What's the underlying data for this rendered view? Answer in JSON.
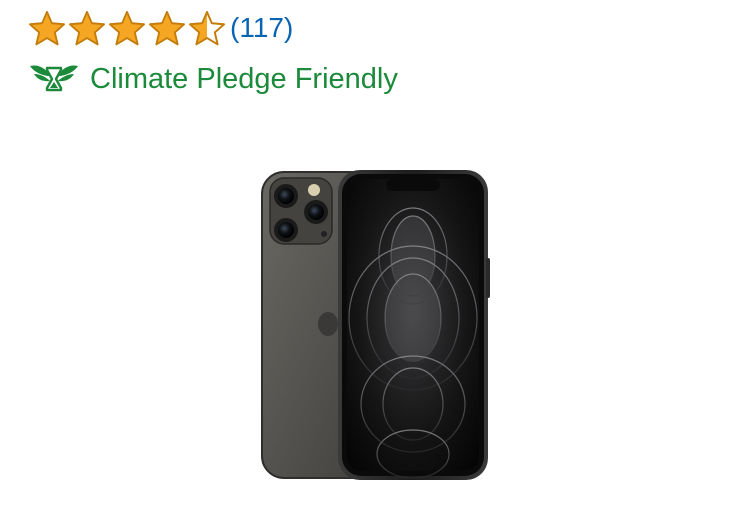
{
  "rating": {
    "value": 4.5,
    "max": 5,
    "review_count": "(117)",
    "star_color": "#f5a623",
    "star_outline": "#c47d0b",
    "link_color": "#0a64b4"
  },
  "badge": {
    "label": "Climate Pledge Friendly",
    "icon": "climate-pledge-leaf-icon",
    "color": "#1b8a3a"
  },
  "product": {
    "image": "phone-product-image",
    "color": "graphite"
  }
}
